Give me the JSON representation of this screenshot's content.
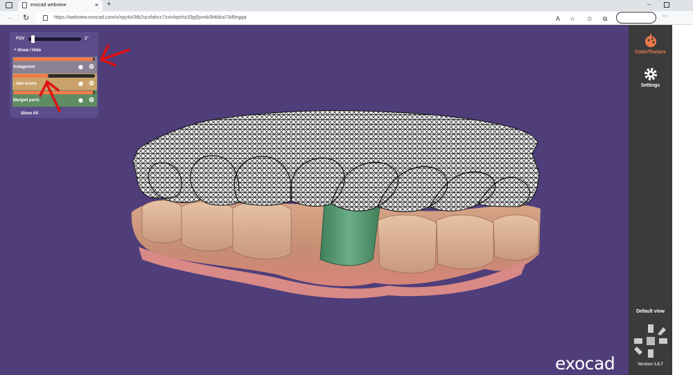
{
  "browser": {
    "tab_title": "exocad webview",
    "tab_close": "×",
    "new_tab": "+",
    "url": "https://webview.exocad.com/v/npy4zl3tb2ucsfahcc7zxir4qsrhz33pj5jvmb3hkbka73d5ngqa",
    "minimize": "–"
  },
  "panel": {
    "fov_label": "FOV",
    "fov_value": "1°",
    "fov_level": 0.05,
    "show_hide_label": "^  Show / Hide",
    "rows": [
      {
        "label": "Antagonist",
        "opacity": 0.98
      },
      {
        "label": "› Jaw scans",
        "opacity": 0.43
      },
      {
        "label": "Merged parts",
        "opacity": 0.98
      }
    ],
    "show_all": "Show All"
  },
  "sidebar": {
    "color_texture": "Color/Texture",
    "settings": "Settings",
    "default_view": "Default view",
    "version": "Version 1.6.7"
  },
  "brand": "exocad",
  "colors": {
    "viewport_bg": "#4f3e7a",
    "accent": "#f07a4b",
    "sidebar_bg": "#3b3b3b",
    "annotation_arrow": "#e01010"
  },
  "icons": {
    "eye": "eye-icon",
    "gear": "gear-icon",
    "palette": "palette-icon",
    "settings": "settings-gear-icon",
    "view_cube": "view-cube-icon"
  }
}
